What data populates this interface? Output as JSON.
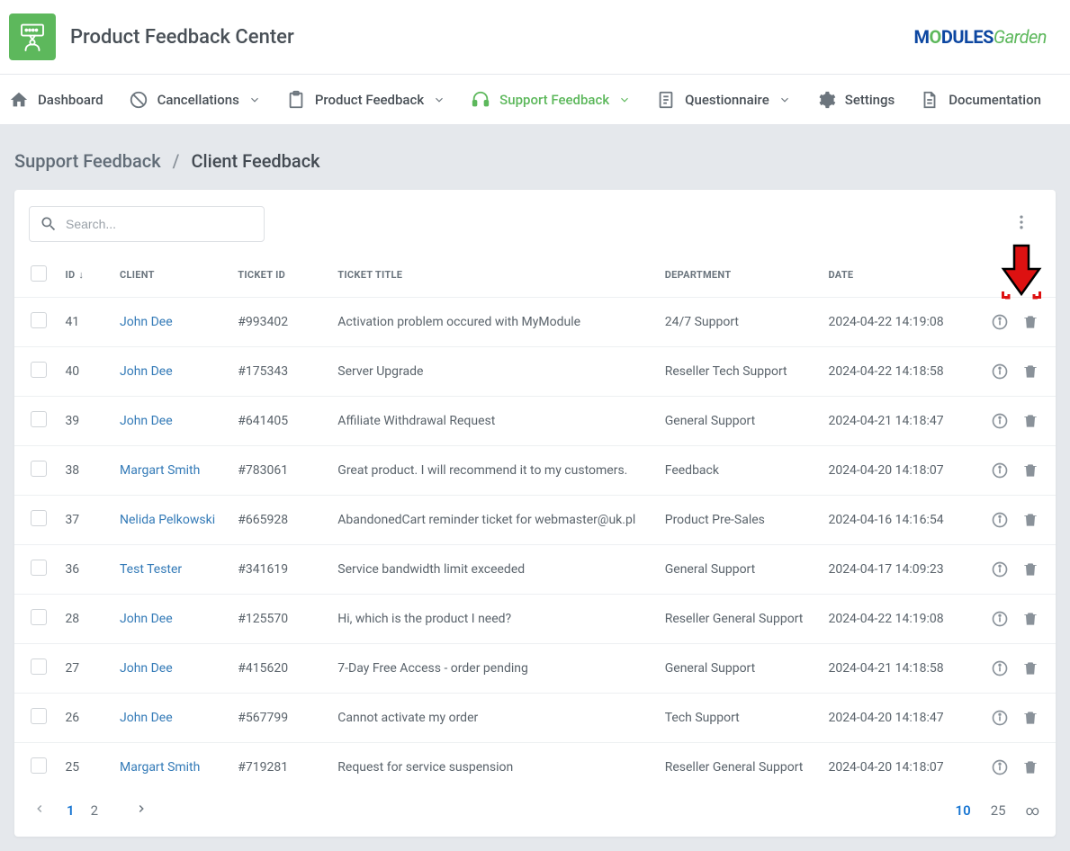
{
  "app": {
    "title": "Product Feedback Center"
  },
  "brand": {
    "text1": "M",
    "o": "O",
    "text2": "DULES",
    "garden": "Garden"
  },
  "nav": {
    "dashboard": "Dashboard",
    "cancellations": "Cancellations",
    "product_feedback": "Product Feedback",
    "support_feedback": "Support Feedback",
    "questionnaire": "Questionnaire",
    "settings": "Settings",
    "documentation": "Documentation"
  },
  "breadcrumbs": {
    "parent": "Support Feedback",
    "current": "Client Feedback"
  },
  "search": {
    "placeholder": "Search..."
  },
  "columns": {
    "id": "ID",
    "client": "CLIENT",
    "ticket_id": "TICKET ID",
    "ticket_title": "TICKET TITLE",
    "department": "DEPARTMENT",
    "date": "DATE"
  },
  "rows": [
    {
      "id": "41",
      "client": "John Dee",
      "ticket_id": "#993402",
      "title": "Activation problem occured with MyModule",
      "department": "24/7 Support",
      "date": "2024-04-22 14:19:08"
    },
    {
      "id": "40",
      "client": "John Dee",
      "ticket_id": "#175343",
      "title": "Server Upgrade",
      "department": "Reseller Tech Support",
      "date": "2024-04-22 14:18:58"
    },
    {
      "id": "39",
      "client": "John Dee",
      "ticket_id": "#641405",
      "title": "Affiliate Withdrawal Request",
      "department": "General Support",
      "date": "2024-04-21 14:18:47"
    },
    {
      "id": "38",
      "client": "Margart Smith",
      "ticket_id": "#783061",
      "title": "Great product. I will recommend it to my customers.",
      "department": "Feedback",
      "date": "2024-04-20 14:18:07"
    },
    {
      "id": "37",
      "client": "Nelida Pelkowski",
      "ticket_id": "#665928",
      "title": "AbandonedCart reminder ticket for webmaster@uk.pl",
      "department": "Product Pre-Sales",
      "date": "2024-04-16 14:16:54"
    },
    {
      "id": "36",
      "client": "Test Tester",
      "ticket_id": "#341619",
      "title": "Service bandwidth limit exceeded",
      "department": "General Support",
      "date": "2024-04-17 14:09:23"
    },
    {
      "id": "28",
      "client": "John Dee",
      "ticket_id": "#125570",
      "title": "Hi, which is the product I need?",
      "department": "Reseller General Support",
      "date": "2024-04-22 14:19:08"
    },
    {
      "id": "27",
      "client": "John Dee",
      "ticket_id": "#415620",
      "title": "7-Day Free Access - order pending",
      "department": "General Support",
      "date": "2024-04-21 14:18:58"
    },
    {
      "id": "26",
      "client": "John Dee",
      "ticket_id": "#567799",
      "title": "Cannot activate my order",
      "department": "Tech Support",
      "date": "2024-04-20 14:18:47"
    },
    {
      "id": "25",
      "client": "Margart Smith",
      "ticket_id": "#719281",
      "title": "Request for service suspension",
      "department": "Reseller General Support",
      "date": "2024-04-20 14:18:07"
    }
  ],
  "pagination": {
    "pages": [
      "1",
      "2"
    ],
    "active_page": "1",
    "sizes": [
      "10",
      "25",
      "∞"
    ],
    "active_size": "10"
  }
}
